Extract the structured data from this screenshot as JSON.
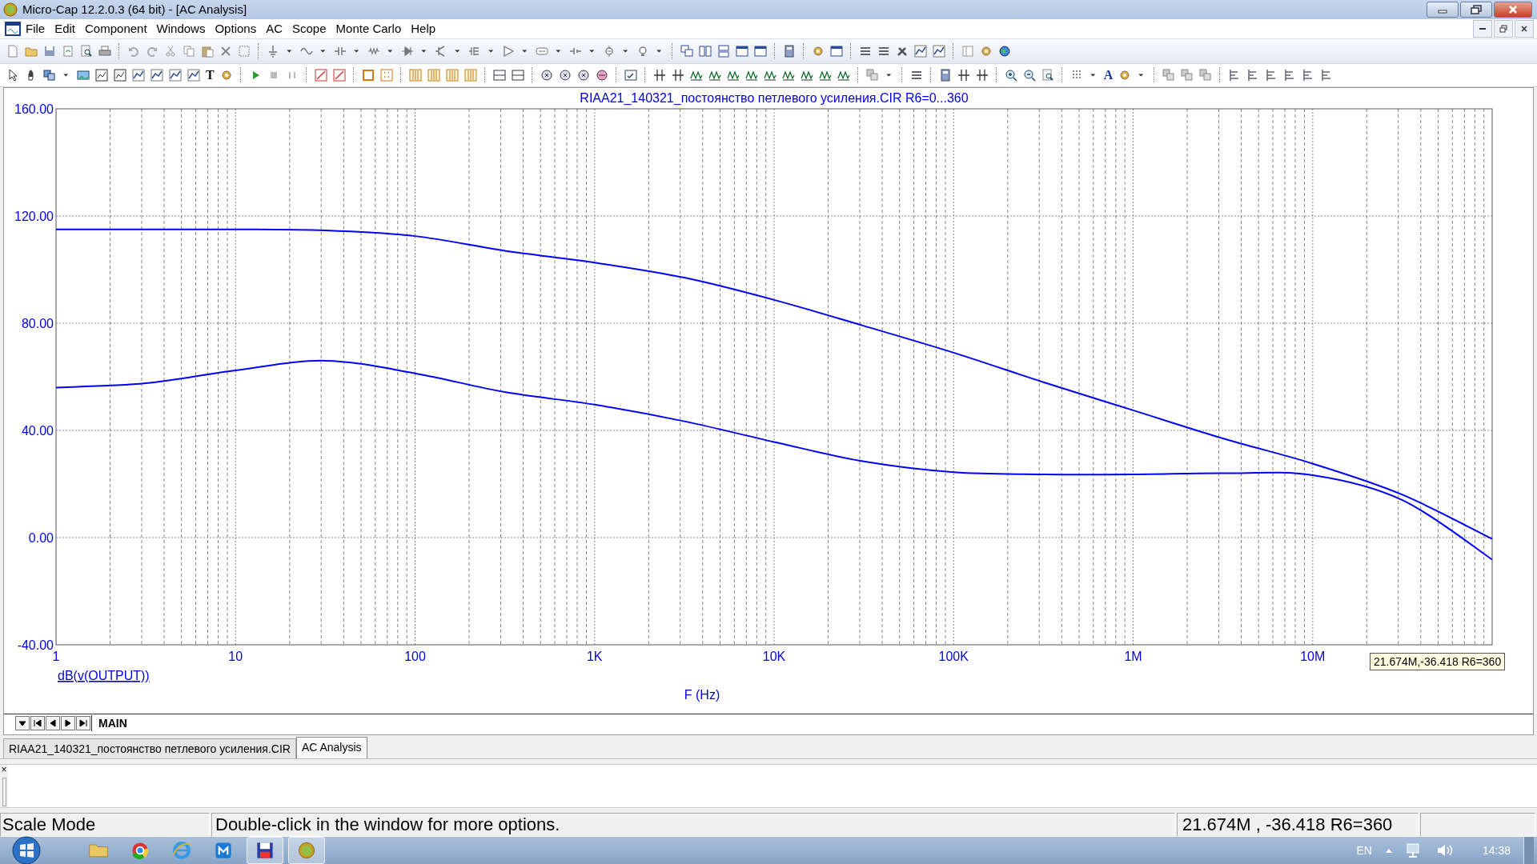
{
  "window": {
    "title": "Micro-Cap 12.2.0.3 (64 bit) - [AC Analysis]"
  },
  "menu": [
    "File",
    "Edit",
    "Component",
    "Windows",
    "Options",
    "AC",
    "Scope",
    "Monte Carlo",
    "Help"
  ],
  "toolbar": {
    "text_tool": "T",
    "font_tool": "A"
  },
  "plot": {
    "tooltip": "21.674M,-36.418 R6=360",
    "trace_label": "dB(v(OUTPUT))",
    "chart_data": {
      "type": "line",
      "title": "RIAA21_140321_постоянство петлевого усиления.CIR R6=0...360",
      "xlabel": "F (Hz)",
      "grid": true,
      "categories": [
        "1",
        null,
        "10",
        null,
        "100",
        null,
        "1K",
        null,
        "10K",
        null,
        "100K",
        null,
        "1M",
        null,
        "10M",
        null,
        null
      ],
      "series": [
        {
          "color": "#0000ff",
          "values": [
            115,
            115,
            115,
            114.6,
            112.5,
            107,
            102.6,
            97,
            88.7,
            79,
            69,
            58,
            47.5,
            37,
            27.6,
            16,
            -0.5
          ]
        },
        {
          "color": "#0000ff",
          "values": [
            56,
            57.6,
            62.4,
            66,
            61.3,
            54.3,
            49.6,
            43.4,
            35.7,
            28.4,
            24.4,
            23.6,
            23.6,
            24,
            23.3,
            14,
            -8.2
          ]
        }
      ],
      "ylim": [
        -40,
        160
      ],
      "yticks": [
        {
          "value": 160,
          "label": "160.00"
        },
        {
          "value": 120,
          "label": "120.00"
        },
        {
          "value": 80,
          "label": "80.00"
        },
        {
          "value": 40,
          "label": "40.00"
        },
        {
          "value": 0,
          "label": "0.00"
        },
        {
          "value": -40,
          "label": "-40.00"
        }
      ]
    }
  },
  "sheet_tabs": [
    {
      "label": "MAIN",
      "selected": true
    }
  ],
  "doc_tabs": [
    {
      "label": "RIAA21_140321_постоянство петлевого усиления.CIR",
      "selected": false
    },
    {
      "label": "AC Analysis",
      "selected": true
    }
  ],
  "output_pane": {
    "close": "×"
  },
  "status_bar": {
    "mode": "Scale Mode",
    "hint": "Double-click in the window for more options.",
    "cursor": "21.674M , -36.418 R6=360"
  },
  "taskbar": {
    "apps": [
      {
        "kind": "folder",
        "selected": false
      },
      {
        "kind": "chrome",
        "selected": false
      },
      {
        "kind": "ie",
        "selected": false
      },
      {
        "kind": "maxthon",
        "selected": false
      },
      {
        "kind": "floppy",
        "selected": true
      },
      {
        "kind": "microcap",
        "selected": true
      }
    ],
    "language": "EN",
    "clock": "14:38"
  }
}
